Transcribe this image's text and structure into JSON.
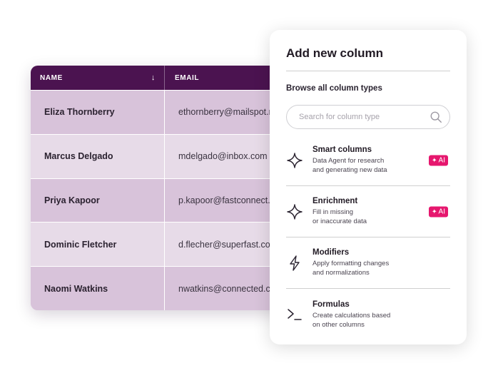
{
  "table": {
    "headers": {
      "name": "NAME",
      "email": "EMAIL"
    },
    "sort_icon": "↓",
    "rows": [
      {
        "name": "Eliza Thornberry",
        "email": "ethornberry@mailspot.net"
      },
      {
        "name": "Marcus Delgado",
        "email": "mdelgado@inbox.com"
      },
      {
        "name": "Priya Kapoor",
        "email": "p.kapoor@fastconnect.com"
      },
      {
        "name": "Dominic Fletcher",
        "email": "d.flecher@superfast.com"
      },
      {
        "name": "Naomi Watkins",
        "email": "nwatkins@connected.com"
      }
    ]
  },
  "panel": {
    "title": "Add new column",
    "browse_label": "Browse all column types",
    "search_placeholder": "Search for column type",
    "types": [
      {
        "title": "Smart columns",
        "desc1": "Data Agent for research",
        "desc2": "and generating new data",
        "icon": "sparkle-icon",
        "badge": "AI"
      },
      {
        "title": "Enrichment",
        "desc1": "Fill in missing",
        "desc2": "or inaccurate data",
        "icon": "sparkle-icon",
        "badge": "AI"
      },
      {
        "title": "Modifiers",
        "desc1": "Apply formatting changes",
        "desc2": "and normalizations",
        "icon": "lightning-icon",
        "badge": ""
      },
      {
        "title": "Formulas",
        "desc1": "Create calculations based",
        "desc2": "on other columns",
        "icon": "terminal-icon",
        "badge": ""
      }
    ],
    "badge_star": "✦"
  },
  "colors": {
    "header_bg": "#4b1350",
    "row_odd": "#d8c3da",
    "row_even": "#e7dbe8",
    "ai_badge": "#e6176e"
  }
}
